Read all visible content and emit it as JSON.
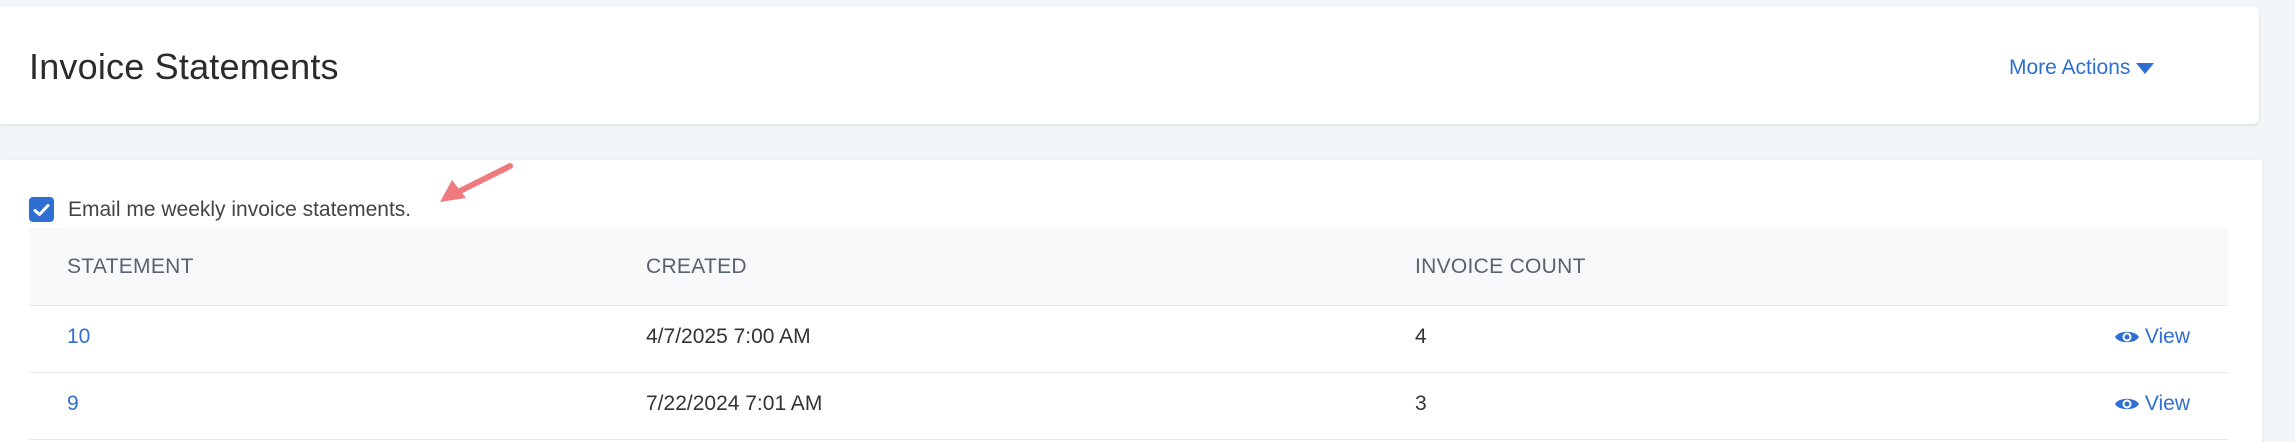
{
  "header": {
    "title": "Invoice Statements",
    "more_actions_label": "More Actions"
  },
  "settings": {
    "email_weekly_label": "Email me weekly invoice statements.",
    "email_weekly_checked": true
  },
  "table": {
    "columns": [
      "STATEMENT",
      "CREATED",
      "INVOICE COUNT"
    ],
    "rows": [
      {
        "statement": "10",
        "created": "4/7/2025 7:00 AM",
        "invoice_count": "4",
        "action": "View"
      },
      {
        "statement": "9",
        "created": "7/22/2024 7:01 AM",
        "invoice_count": "3",
        "action": "View"
      }
    ]
  },
  "colors": {
    "accent": "#2f6fd1",
    "annotation_arrow": "#f07b7f"
  },
  "icons": {
    "dropdown": "caret-down-icon",
    "view": "eye-icon",
    "checkbox": "check-icon"
  }
}
